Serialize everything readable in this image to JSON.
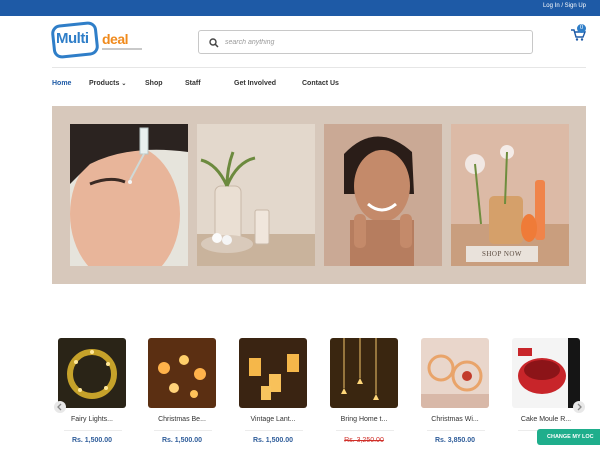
{
  "topbar": {
    "auth_link": "Log In / Sign Up"
  },
  "logo": {
    "part1": "Multi",
    "part2": "deal"
  },
  "search": {
    "placeholder": "search anything",
    "value": ""
  },
  "cart": {
    "count": "0"
  },
  "nav": {
    "items": [
      {
        "label": "Home",
        "active": true
      },
      {
        "label": "Products",
        "dropdown": true
      },
      {
        "label": "Shop"
      },
      {
        "label": "Staff"
      },
      {
        "label": "Get Involved"
      },
      {
        "label": "Contact Us"
      }
    ]
  },
  "banner": {
    "cta": "SHOP NOW"
  },
  "products": [
    {
      "name": "Fairy Lights...",
      "price": "Rs. 1,500.00",
      "strike": false
    },
    {
      "name": "Christmas Be...",
      "price": "Rs. 1,500.00",
      "strike": false
    },
    {
      "name": "Vintage Lant...",
      "price": "Rs. 1,500.00",
      "strike": false
    },
    {
      "name": "Bring Home t...",
      "price": "Rs. 3,250.00",
      "strike": true
    },
    {
      "name": "Christmas Wi...",
      "price": "Rs. 3,850.00",
      "strike": false
    },
    {
      "name": "Cake Moule R...",
      "price": "",
      "strike": false
    }
  ],
  "floating": {
    "change_location": "CHANGE MY LOC"
  },
  "colors": {
    "brand_blue": "#1e5aa6",
    "brand_orange": "#f08a1c",
    "banner_bg": "#d7c8bb",
    "teal": "#1fae8c"
  }
}
